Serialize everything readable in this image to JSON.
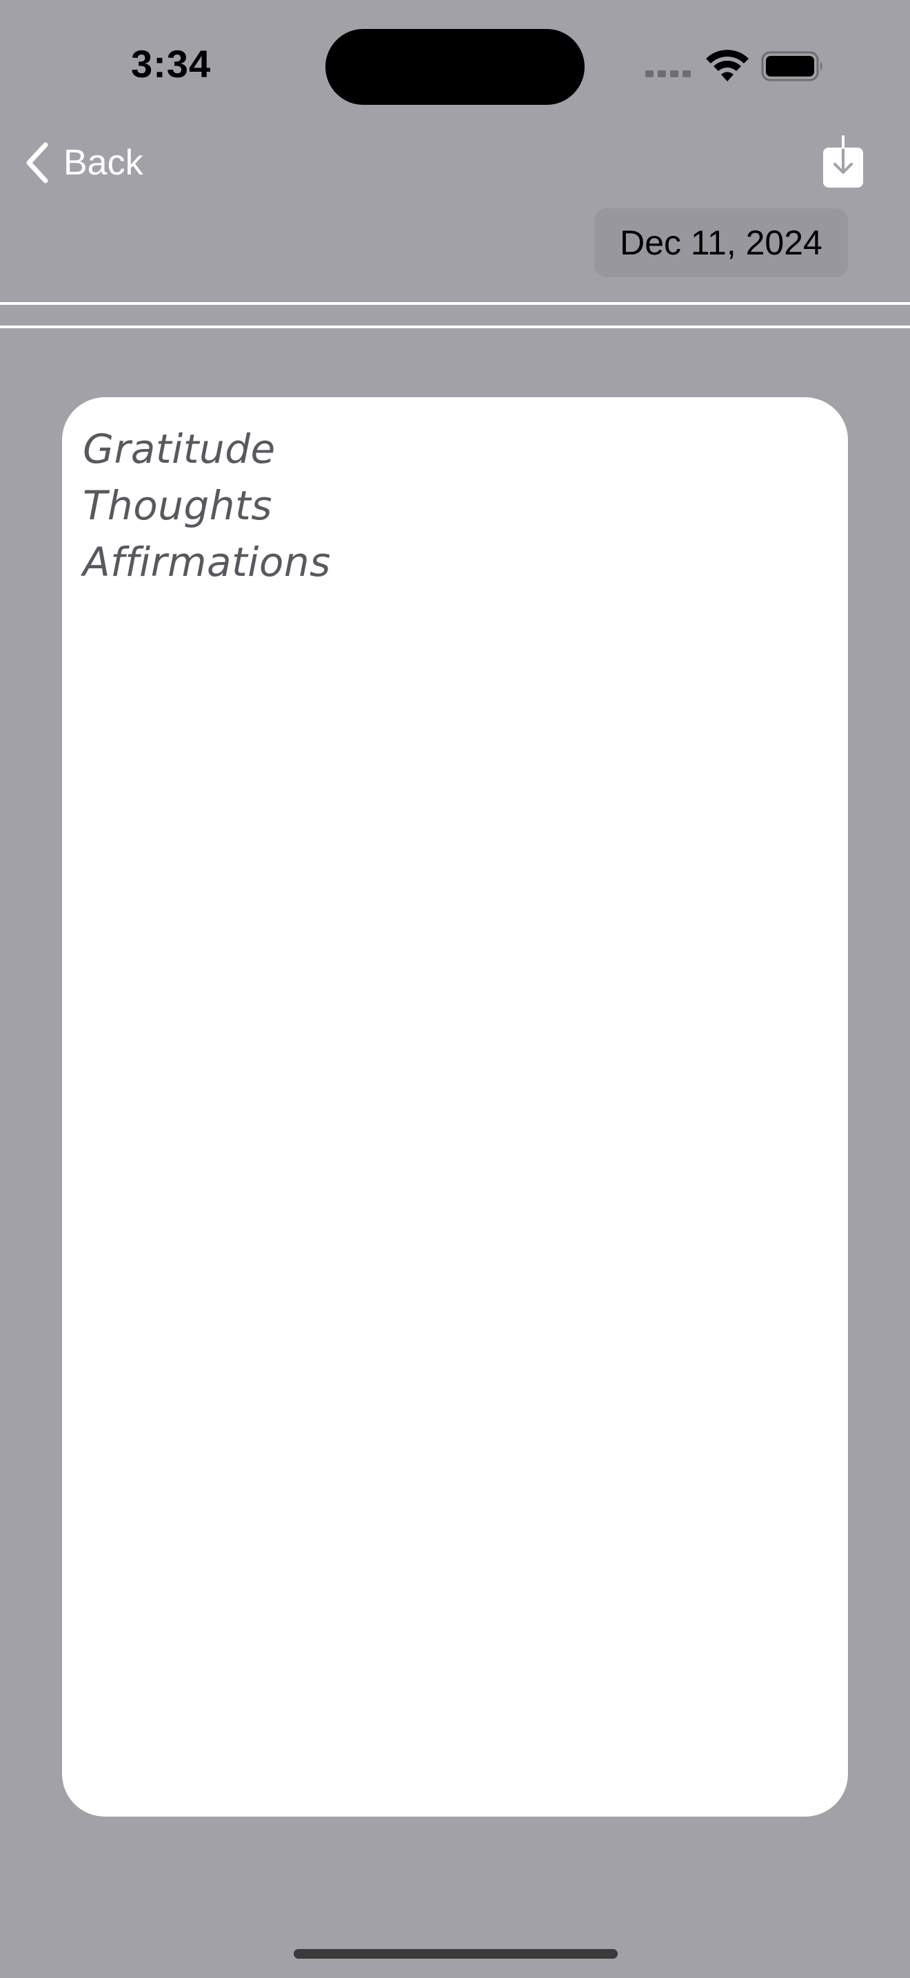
{
  "status_bar": {
    "time": "3:34"
  },
  "nav": {
    "back_label": "Back",
    "back_icon": "chevron-left-icon",
    "download_icon": "download-icon"
  },
  "date_pill": {
    "label": "Dec 11, 2024"
  },
  "journal": {
    "lines": [
      "Gratitude",
      "Thoughts",
      "Affirmations"
    ]
  },
  "colors": {
    "background": "#a3a1a8",
    "card": "#ffffff",
    "divider": "#ffffff",
    "date_pill": "#98979d"
  }
}
